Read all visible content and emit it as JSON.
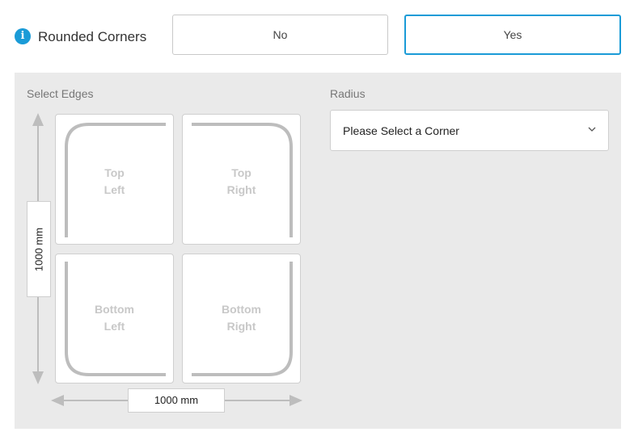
{
  "rounded_corners": {
    "label": "Rounded Corners",
    "info_icon": "info-icon",
    "options": {
      "no": "No",
      "yes": "Yes"
    },
    "selected": "Yes"
  },
  "select_edges": {
    "label": "Select Edges",
    "corners": {
      "top_left": {
        "line1": "Top",
        "line2": "Left"
      },
      "top_right": {
        "line1": "Top",
        "line2": "Right"
      },
      "bottom_left": {
        "line1": "Bottom",
        "line2": "Left"
      },
      "bottom_right": {
        "line1": "Bottom",
        "line2": "Right"
      }
    },
    "height_dimension": "1000 mm",
    "width_dimension": "1000 mm"
  },
  "radius": {
    "label": "Radius",
    "placeholder": "Please Select a Corner",
    "icon": "chevron-down-icon"
  },
  "colors": {
    "accent": "#1a9bd7",
    "panel": "#eaeaea",
    "corner_line": "#bdbdbd"
  }
}
